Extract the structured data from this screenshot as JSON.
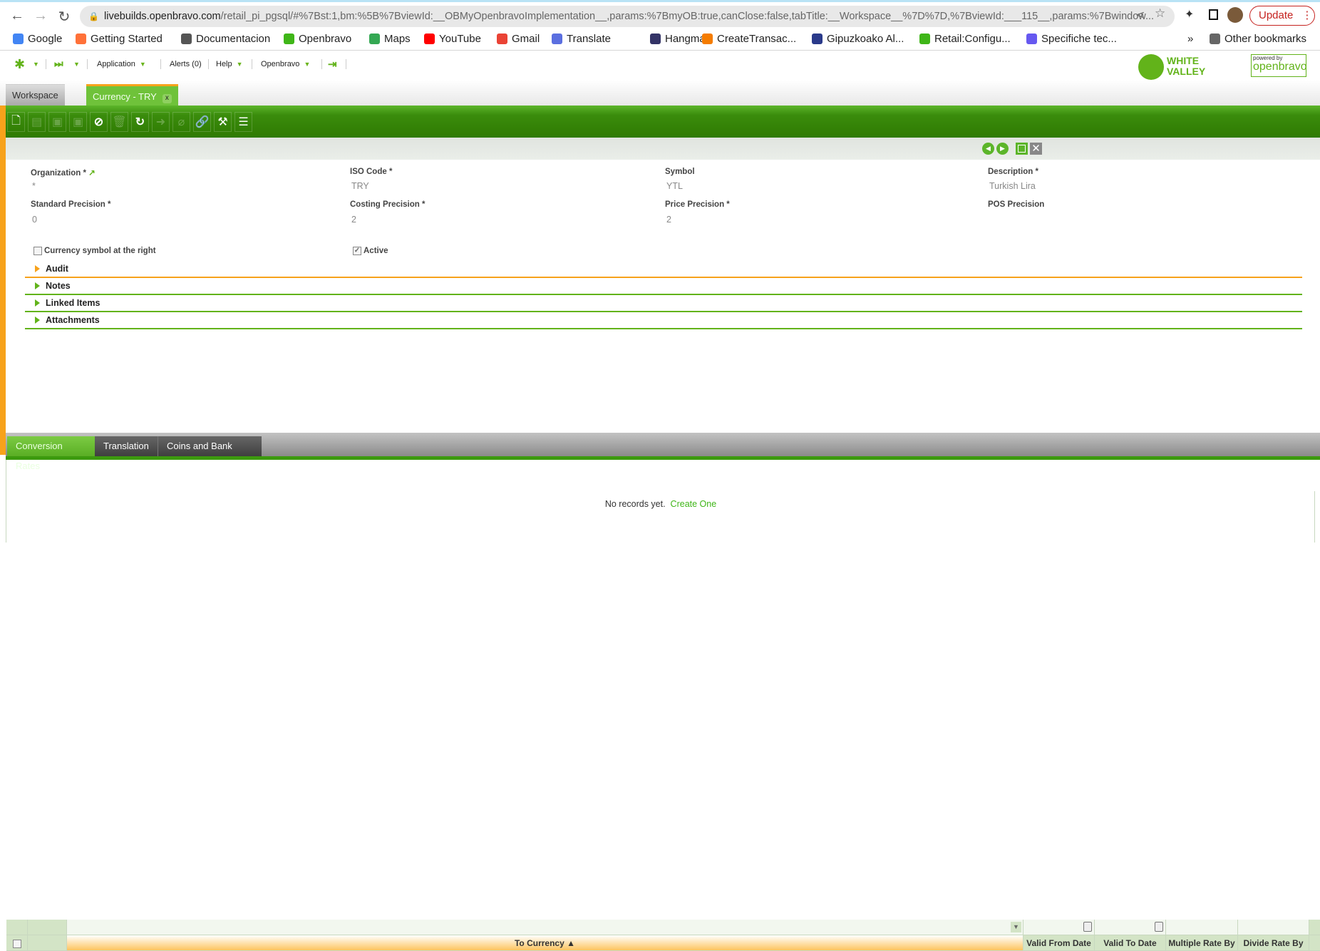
{
  "browser": {
    "url_host": "livebuilds.openbravo.com",
    "url_path": "/retail_pi_pgsql/#%7Bst:1,bm:%5B%7BviewId:__OBMyOpenbravoImplementation__,params:%7BmyOB:true,canClose:false,tabTitle:__Workspace__%7D%7D,%7BviewId:___115__,params:%7Bwindow...",
    "update_label": "Update",
    "bookmarks": [
      {
        "label": "Google",
        "color": "#4285f4"
      },
      {
        "label": "Getting Started",
        "color": "#ff7139"
      },
      {
        "label": "Documentacion",
        "color": "#555555"
      },
      {
        "label": "Openbravo",
        "color": "#3fb618"
      },
      {
        "label": "Maps",
        "color": "#34a853"
      },
      {
        "label": "YouTube",
        "color": "#ff0000"
      },
      {
        "label": "Gmail",
        "color": "#ea4335"
      },
      {
        "label": "Translate",
        "color": "#5b6fe0"
      },
      {
        "label": "Hangman",
        "color": "#333366"
      },
      {
        "label": "CreateTransac...",
        "color": "#f57c00"
      },
      {
        "label": "Gipuzkoako Al...",
        "color": "#2a3a8a"
      },
      {
        "label": "Retail:Configu...",
        "color": "#3fb618"
      },
      {
        "label": "Specifiche tec...",
        "color": "#6658f0"
      }
    ],
    "more": "»",
    "other_bookmarks": "Other bookmarks"
  },
  "appnav": {
    "application": "Application",
    "alerts": "Alerts (0)",
    "help": "Help",
    "openbravo": "Openbravo"
  },
  "logos": {
    "white_valley": "WHITE VALLEY",
    "powered_by": "powered by",
    "openbravo": "openbravo"
  },
  "tabs": {
    "workspace": "Workspace",
    "currency": "Currency - TRY",
    "close": "x"
  },
  "form": {
    "organization": {
      "label": "Organization *",
      "value": "*"
    },
    "iso_code": {
      "label": "ISO Code *",
      "value": "TRY"
    },
    "symbol": {
      "label": "Symbol",
      "value": "YTL"
    },
    "description": {
      "label": "Description *",
      "value": "Turkish Lira"
    },
    "standard_precision": {
      "label": "Standard Precision *",
      "value": "0"
    },
    "costing_precision": {
      "label": "Costing Precision *",
      "value": "2"
    },
    "price_precision": {
      "label": "Price Precision *",
      "value": "2"
    },
    "pos_precision": {
      "label": "POS Precision",
      "value": ""
    },
    "currency_symbol_right": {
      "label": "Currency symbol at the right",
      "checked": false
    },
    "active": {
      "label": "Active",
      "checked": true,
      "mark": "✓"
    }
  },
  "sections": [
    "Audit",
    "Notes",
    "Linked Items",
    "Attachments"
  ],
  "subtabs": [
    "Conversion Rates",
    "Translation",
    "Coins and Bank notes"
  ],
  "grid": {
    "columns": [
      "To Currency ▲",
      "Valid From Date",
      "Valid To Date",
      "Multiple Rate By",
      "Divide Rate By"
    ],
    "empty": "No records yet.",
    "create": "Create One"
  },
  "colors": {
    "green": "#62b31a",
    "orange": "#f7a21b",
    "dark_green": "#2f7a02"
  }
}
